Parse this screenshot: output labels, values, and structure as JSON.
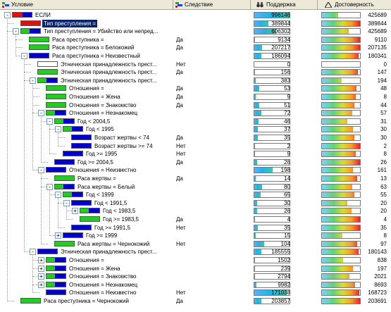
{
  "columns": {
    "condition": "Условие",
    "consequence": "Следствие",
    "support": "Поддержка",
    "confidence": "Достоверность"
  },
  "rows": [
    {
      "depth": 0,
      "exp": "-",
      "label": "ЕСЛИ",
      "cons": "",
      "sup": "996146",
      "conf": "425689",
      "sf": 1.0,
      "cf": 0.43,
      "bar": "red-blue",
      "selected": false
    },
    {
      "depth": 1,
      "exp": "",
      "label": "Тип преступления =",
      "cons": "",
      "sup": "389844",
      "conf": "389844",
      "sf": 0.39,
      "cf": 1.0,
      "bar": "red",
      "selected": true
    },
    {
      "depth": 1,
      "exp": "-",
      "label": "Тип преступления = Убийство или непред...",
      "cons": "",
      "sup": "606302",
      "conf": "425689",
      "sf": 0.61,
      "cf": 0.7,
      "bar": "green-blue",
      "selected": false
    },
    {
      "depth": 2,
      "exp": "",
      "label": "Раса преступника =",
      "cons": "Да",
      "sup": "9134",
      "conf": "9110",
      "sf": 0.01,
      "cf": 1.0,
      "bar": "green",
      "selected": false
    },
    {
      "depth": 2,
      "exp": "",
      "label": "Раса преступника = Белокожий",
      "cons": "Да",
      "sup": "207217",
      "conf": "207135",
      "sf": 0.21,
      "cf": 1.0,
      "bar": "green",
      "selected": false
    },
    {
      "depth": 2,
      "exp": "-",
      "label": "Раса преступника = Неизвестный",
      "cons": "",
      "sup": "186094",
      "conf": "180341",
      "sf": 0.19,
      "cf": 0.97,
      "bar": "blue",
      "selected": false
    },
    {
      "depth": 3,
      "exp": "",
      "label": "Этническая принадлежность прест...",
      "cons": "Нет",
      "sup": "0",
      "conf": "0",
      "sf": 0.0,
      "cf": 0.0,
      "bar": "empty",
      "selected": false
    },
    {
      "depth": 3,
      "exp": "",
      "label": "Этническая принадлежность прест...",
      "cons": "Да",
      "sup": "156",
      "conf": "147",
      "sf": 0.02,
      "cf": 0.94,
      "bar": "green",
      "selected": false
    },
    {
      "depth": 3,
      "exp": "-",
      "label": "Этническая принадлежность прест...",
      "cons": "",
      "sup": "383",
      "conf": "194",
      "sf": 0.04,
      "cf": 0.51,
      "bar": "green-blue",
      "selected": false
    },
    {
      "depth": 4,
      "exp": "",
      "label": "Отношения =",
      "cons": "Да",
      "sup": "53",
      "conf": "48",
      "sf": 0.14,
      "cf": 0.9,
      "bar": "green",
      "selected": false
    },
    {
      "depth": 4,
      "exp": "",
      "label": "Отношения = Жена",
      "cons": "Да",
      "sup": "9",
      "conf": "8",
      "sf": 0.03,
      "cf": 0.89,
      "bar": "green",
      "selected": false
    },
    {
      "depth": 4,
      "exp": "",
      "label": "Отношения = Знакомство",
      "cons": "Да",
      "sup": "51",
      "conf": "44",
      "sf": 0.13,
      "cf": 0.86,
      "bar": "green",
      "selected": false
    },
    {
      "depth": 4,
      "exp": "-",
      "label": "Отношения = Незнакомец",
      "cons": "",
      "sup": "72",
      "conf": "57",
      "sf": 0.19,
      "cf": 0.79,
      "bar": "green-blue",
      "selected": false
    },
    {
      "depth": 5,
      "exp": "-",
      "label": "Год < 2004,5",
      "cons": "",
      "sup": "46",
      "conf": "31",
      "sf": 0.12,
      "cf": 0.67,
      "bar": "green-blue",
      "selected": false
    },
    {
      "depth": 6,
      "exp": "-",
      "label": "Год < 1995",
      "cons": "",
      "sup": "37",
      "conf": "30",
      "sf": 0.1,
      "cf": 0.81,
      "bar": "green-blue",
      "selected": false
    },
    {
      "depth": 7,
      "exp": "",
      "label": "Возраст жертвы < 74",
      "cons": "Да",
      "sup": "35",
      "conf": "30",
      "sf": 0.09,
      "cf": 0.86,
      "bar": "blue",
      "selected": false
    },
    {
      "depth": 7,
      "exp": "",
      "label": "Возраст жертвы >= 74",
      "cons": "Нет",
      "sup": "2",
      "conf": "2",
      "sf": 0.01,
      "cf": 1.0,
      "bar": "blue",
      "selected": false
    },
    {
      "depth": 6,
      "exp": "",
      "label": "Год >= 1995",
      "cons": "Нет",
      "sup": "9",
      "conf": "8",
      "sf": 0.02,
      "cf": 0.89,
      "bar": "blue",
      "selected": false
    },
    {
      "depth": 5,
      "exp": "",
      "label": "Год >= 2004,5",
      "cons": "Да",
      "sup": "26",
      "conf": "26",
      "sf": 0.07,
      "cf": 1.0,
      "bar": "blue",
      "selected": false
    },
    {
      "depth": 4,
      "exp": "-",
      "label": "Отношения = Неизвестно",
      "cons": "",
      "sup": "198",
      "conf": "161",
      "sf": 0.52,
      "cf": 0.81,
      "bar": "blue",
      "selected": false
    },
    {
      "depth": 5,
      "exp": "",
      "label": "Раса жертвы =",
      "cons": "Да",
      "sup": "14",
      "conf": "13",
      "sf": 0.04,
      "cf": 0.93,
      "bar": "green",
      "selected": false
    },
    {
      "depth": 5,
      "exp": "-",
      "label": "Раса жертвы = Белый",
      "cons": "",
      "sup": "80",
      "conf": "63",
      "sf": 0.21,
      "cf": 0.79,
      "bar": "green-blue",
      "selected": false
    },
    {
      "depth": 6,
      "exp": "-",
      "label": "Год < 1999",
      "cons": "",
      "sup": "65",
      "conf": "55",
      "sf": 0.17,
      "cf": 0.85,
      "bar": "green-blue",
      "selected": false
    },
    {
      "depth": 7,
      "exp": "-",
      "label": "Год < 1991,5",
      "cons": "",
      "sup": "30",
      "conf": "20",
      "sf": 0.08,
      "cf": 0.67,
      "bar": "blue",
      "selected": false
    },
    {
      "depth": 8,
      "exp": "+",
      "label": "Год < 1983,5",
      "cons": "",
      "sup": "26",
      "conf": "20",
      "sf": 0.07,
      "cf": 0.77,
      "bar": "green-blue",
      "selected": false
    },
    {
      "depth": 8,
      "exp": "",
      "label": "Год >= 1983,5",
      "cons": "Да",
      "sup": "4",
      "conf": "4",
      "sf": 0.01,
      "cf": 1.0,
      "bar": "green",
      "selected": false
    },
    {
      "depth": 7,
      "exp": "",
      "label": "Год >= 1991,5",
      "cons": "Нет",
      "sup": "35",
      "conf": "35",
      "sf": 0.09,
      "cf": 1.0,
      "bar": "blue",
      "selected": false
    },
    {
      "depth": 6,
      "exp": "+",
      "label": "Год >= 1999",
      "cons": "",
      "sup": "15",
      "conf": "8",
      "sf": 0.04,
      "cf": 0.53,
      "bar": "blue",
      "selected": false
    },
    {
      "depth": 5,
      "exp": "",
      "label": "Раса жертвы = Чернокожий",
      "cons": "Нет",
      "sup": "104",
      "conf": "97",
      "sf": 0.27,
      "cf": 0.93,
      "bar": "green",
      "selected": false
    },
    {
      "depth": 3,
      "exp": "-",
      "label": "Этническая принадлежность прест...",
      "cons": "",
      "sup": "185555",
      "conf": "180143",
      "sf": 0.19,
      "cf": 0.97,
      "bar": "blue",
      "selected": false
    },
    {
      "depth": 4,
      "exp": "+",
      "label": "Отношения =",
      "cons": "",
      "sup": "1502",
      "conf": "838",
      "sf": 0.01,
      "cf": 0.56,
      "bar": "green-blue",
      "selected": false
    },
    {
      "depth": 4,
      "exp": "+",
      "label": "Отношения = Жена",
      "cons": "",
      "sup": "239",
      "conf": "197",
      "sf": 0.01,
      "cf": 0.82,
      "bar": "green-blue",
      "selected": false
    },
    {
      "depth": 4,
      "exp": "+",
      "label": "Отношения = Знакомство",
      "cons": "",
      "sup": "2794",
      "conf": "2021",
      "sf": 0.02,
      "cf": 0.72,
      "bar": "green-blue",
      "selected": false
    },
    {
      "depth": 4,
      "exp": "+",
      "label": "Отношения = Незнакомец",
      "cons": "",
      "sup": "9982",
      "conf": "8693",
      "sf": 0.05,
      "cf": 0.87,
      "bar": "green-blue",
      "selected": false
    },
    {
      "depth": 4,
      "exp": "",
      "label": "Отношения = Неизвестно",
      "cons": "Нет",
      "sup": "171038",
      "conf": "168723",
      "sf": 0.92,
      "cf": 0.99,
      "bar": "blue",
      "selected": false
    },
    {
      "depth": 1,
      "exp": "",
      "label": "Раса преступника = Чернокожий",
      "cons": "Да",
      "sup": "203857",
      "conf": "203691",
      "sf": 0.2,
      "cf": 1.0,
      "bar": "green",
      "selected": false
    }
  ],
  "colors": {
    "green": "#22cc22",
    "blue": "#0000cc",
    "red": "#dd1111",
    "selection": "#0a246a"
  }
}
